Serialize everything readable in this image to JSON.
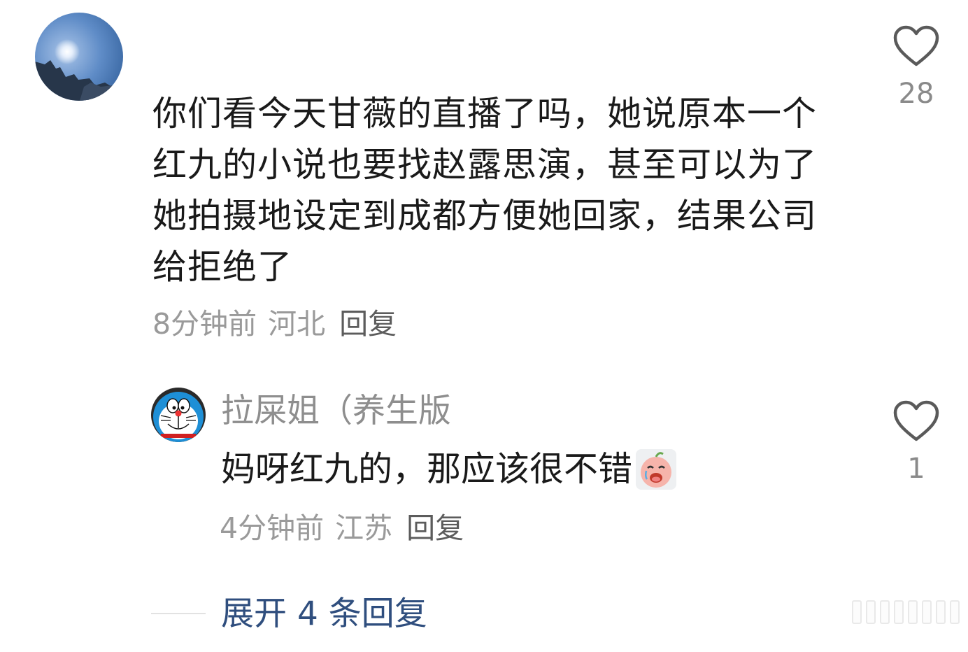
{
  "main_comment": {
    "avatar": "user-avatar-sky",
    "text": "你们看今天甘薇的直播了吗，她说原本一个红九的小说也要找赵露思演，甚至可以为了她拍摄地设定到成都方便她回家，结果公司给拒绝了",
    "time": "8分钟前",
    "location": "河北",
    "reply_label": "回复",
    "like_count": "28"
  },
  "reply": {
    "avatar": "user-avatar-doraemon",
    "username": "拉屎姐（养生版",
    "text": "妈呀红九的，那应该很不错",
    "emoji": "crying-face-emoji",
    "time": "4分钟前",
    "location": "江苏",
    "reply_label": "回复",
    "like_count": "1"
  },
  "expand": {
    "label": "展开 4 条回复"
  },
  "colors": {
    "text_primary": "#1a1a1a",
    "text_meta": "#9a9a9a",
    "link_blue": "#2f4e7e",
    "heart_outline": "#5a5a5a"
  }
}
